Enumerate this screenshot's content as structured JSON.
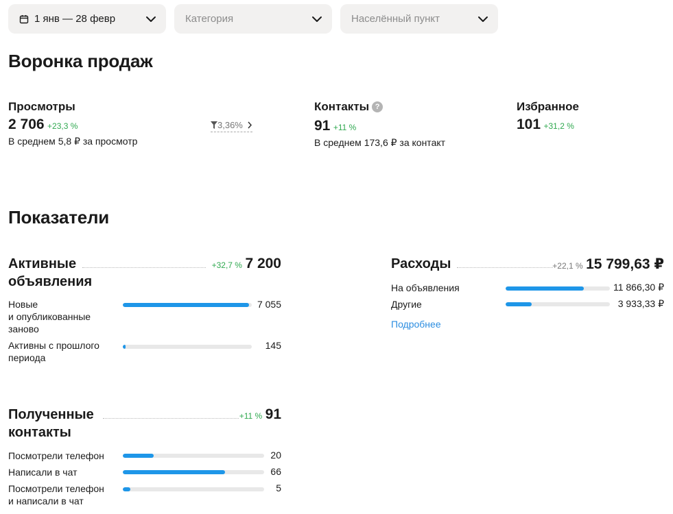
{
  "filters": {
    "date": "1 янв — 28 февр",
    "category_placeholder": "Категория",
    "locality_placeholder": "Населённый пункт"
  },
  "funnel": {
    "title": "Воронка продаж",
    "views": {
      "label": "Просмотры",
      "value": "2 706",
      "delta": "+23,3 %",
      "avg": "В среднем 5,8 ₽ за просмотр"
    },
    "conversion": "3,36%",
    "contacts": {
      "label": "Контакты",
      "help": "?",
      "value": "91",
      "delta": "+11 %",
      "avg": "В среднем 173,6 ₽ за контакт"
    },
    "favorites": {
      "label": "Избранное",
      "value": "101",
      "delta": "+31,2 %"
    }
  },
  "indicators": {
    "title": "Показатели",
    "active_ads": {
      "title_line1": "Активные",
      "title_line2": "объявления",
      "delta": "+32,7 %",
      "value": "7 200",
      "rows": [
        {
          "label_lines": [
            "Новые",
            "и опубликованные",
            "заново"
          ],
          "value": "7 055",
          "fraction": 0.98
        },
        {
          "label_lines": [
            "Активны с прошлого",
            "периода"
          ],
          "value": "145",
          "fraction": 0.02
        }
      ]
    },
    "expenses": {
      "title": "Расходы",
      "delta": "+22,1 %",
      "value": "15 799,63 ₽",
      "rows": [
        {
          "label": "На объявления",
          "value": "11 866,30 ₽",
          "fraction": 0.751
        },
        {
          "label": "Другие",
          "value": "3 933,33 ₽",
          "fraction": 0.249
        }
      ],
      "more_link": "Подробнее"
    },
    "contacts": {
      "title_line1": "Полученные",
      "title_line2": "контакты",
      "delta": "+11 %",
      "value": "91",
      "rows": [
        {
          "label_lines": [
            "Посмотрели телефон"
          ],
          "value": "20",
          "fraction": 0.22
        },
        {
          "label_lines": [
            "Написали в чат"
          ],
          "value": "66",
          "fraction": 0.725
        },
        {
          "label_lines": [
            "Посмотрели телефон",
            "и написали в чат"
          ],
          "value": "5",
          "fraction": 0.055
        }
      ]
    }
  },
  "colors": {
    "accent": "#1e96e8",
    "positive": "#2fa84f",
    "link": "#2b8de0",
    "track": "#e8e8e8"
  }
}
